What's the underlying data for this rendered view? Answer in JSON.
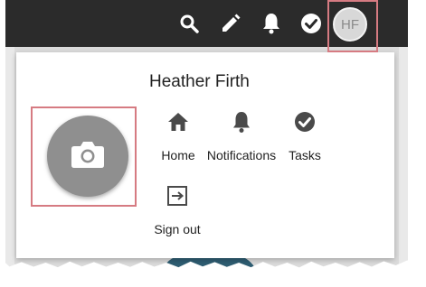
{
  "header": {
    "icons": [
      "search-icon",
      "edit-pencil-icon",
      "bell-icon",
      "check-circle-icon"
    ],
    "avatar_initials": "HF"
  },
  "profile_menu": {
    "user_name": "Heather Firth",
    "photo_icon": "camera-icon",
    "items": [
      {
        "label": "Home",
        "icon": "home-icon"
      },
      {
        "label": "Notifications",
        "icon": "bell-icon"
      },
      {
        "label": "Tasks",
        "icon": "check-circle-icon"
      },
      {
        "label": "Sign out",
        "icon": "sign-out-icon"
      }
    ]
  },
  "colors": {
    "topbar": "#2b2b2b",
    "highlight": "#d67b82",
    "menu_icon": "#4a4a4a",
    "photo_circle": "#8f8f8f"
  }
}
